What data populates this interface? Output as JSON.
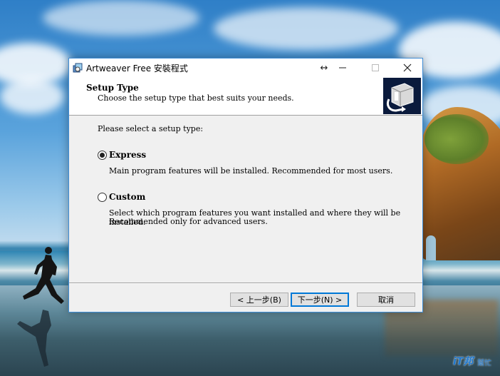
{
  "window": {
    "title": "Artweaver Free 安裝程式",
    "resize_icon": "↔",
    "minimize_icon": "minimize-icon",
    "maximize_icon": "maximize-icon",
    "close_icon": "close-icon"
  },
  "header": {
    "title": "Setup Type",
    "subtitle": "Choose the setup type that best suits your needs."
  },
  "body": {
    "prompt": "Please select a setup type:",
    "options": [
      {
        "label": "Express",
        "selected": true,
        "description": "Main program features will be installed. Recommended for most users."
      },
      {
        "label": "Custom",
        "selected": false,
        "description_line1": "Select which program features you want installed and where they will be installed.",
        "description_line2": "Recommended only for advanced users."
      }
    ]
  },
  "buttons": {
    "back": "< 上一步(B)",
    "next": "下一步(N) >",
    "cancel": "取消"
  },
  "watermark": {
    "logo_text": "iT邦",
    "text2": "幫忙"
  },
  "colors": {
    "window_border": "#3f8dd6",
    "focus_accent": "#0078d7",
    "dialog_bg": "#f0f0f0"
  }
}
